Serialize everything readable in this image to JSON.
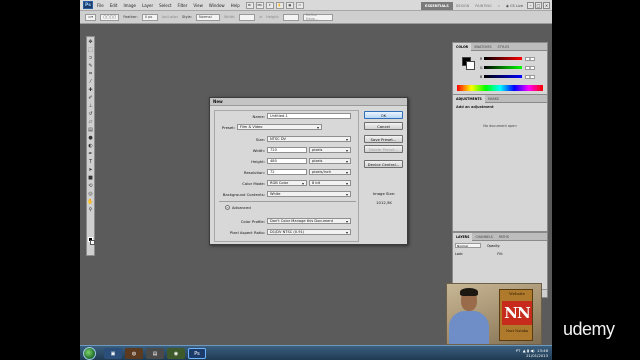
{
  "menubar": {
    "items": [
      "File",
      "Edit",
      "Image",
      "Layer",
      "Select",
      "Filter",
      "View",
      "Window",
      "Help"
    ],
    "workspaces": {
      "active": "ESSENTIALS",
      "others": [
        "DESIGN",
        "PAINTING",
        "»"
      ]
    },
    "cs_live": "CS Live"
  },
  "optbar": {
    "feather_label": "Feather:",
    "feather_value": "0 px",
    "antialias_label": "Anti-alias",
    "style_label": "Style:",
    "style_value": "Normal",
    "width_label": "Width:",
    "height_label": "Height:",
    "refine_label": "Refine Edge..."
  },
  "panels": {
    "color": {
      "tabs": [
        "COLOR",
        "SWATCHES",
        "STYLES"
      ],
      "channels": [
        "R",
        "G",
        "B"
      ],
      "values": [
        "0",
        "0",
        "0"
      ]
    },
    "adjustments": {
      "tabs": [
        "ADJUSTMENTS",
        "MASKS"
      ],
      "title": "Add an adjustment",
      "no_doc": "No document open"
    },
    "layers": {
      "tabs": [
        "LAYERS",
        "CHANNELS",
        "PATHS"
      ],
      "blend_mode": "Normal",
      "opacity_label": "Opacity:",
      "lock_label": "Lock:",
      "fill_label": "Fill:"
    }
  },
  "dialog": {
    "title": "New",
    "fields": {
      "name_label": "Name:",
      "name_value": "Untitled-1",
      "preset_label": "Preset:",
      "preset_value": "Film & Video",
      "size_label": "Size:",
      "size_value": "NTSC DV",
      "width_label": "Width:",
      "width_value": "720",
      "width_unit": "pixels",
      "height_label": "Height:",
      "height_value": "480",
      "height_unit": "pixels",
      "resolution_label": "Resolution:",
      "resolution_value": "72",
      "resolution_unit": "pixels/inch",
      "color_mode_label": "Color Mode:",
      "color_mode_value": "RGB Color",
      "bit_depth": "8 bit",
      "bg_label": "Background Contents:",
      "bg_value": "White",
      "advanced_label": "Advanced",
      "profile_label": "Color Profile:",
      "profile_value": "Don't Color Manage this Document",
      "aspect_label": "Pixel Aspect Ratio:",
      "aspect_value": "D1/DV NTSC (0.91)"
    },
    "buttons": {
      "ok": "OK",
      "cancel": "Cancel",
      "save_preset": "Save Preset...",
      "delete_preset": "Delete Preset...",
      "device_central": "Device Central..."
    },
    "image_size_label": "Image Size:",
    "image_size_value": "1012,5K"
  },
  "webcam": {
    "logo_top": "Website",
    "logo_mark": "NN",
    "logo_bottom": "Nuri Nataka"
  },
  "taskbar": {
    "tray_lang": "PT",
    "time": "13:46",
    "date": "21/01/2013"
  },
  "watermark": "udemy"
}
